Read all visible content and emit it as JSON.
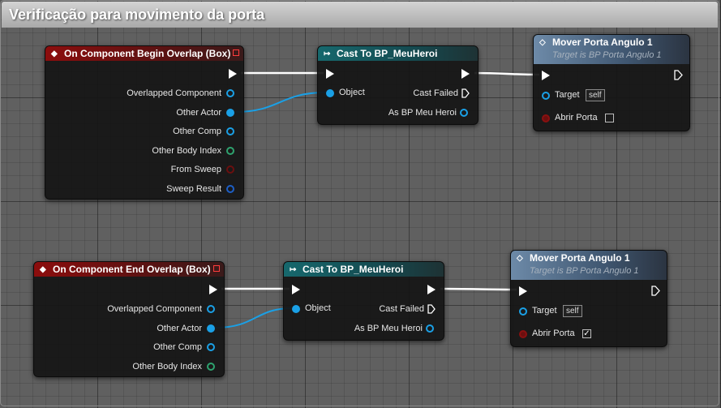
{
  "comment": {
    "title": "Verificação para movimento da porta"
  },
  "colors": {
    "object_pin": "#1aa0e6",
    "struct_pin": "#2ea36f",
    "bool_pin": "#8a1010",
    "wire_exec": "#ffffff",
    "wire_object": "#1aa0e6"
  },
  "event_begin": {
    "title": "On Component Begin Overlap (Box)",
    "pins": [
      "Overlapped Component",
      "Other Actor",
      "Other Comp",
      "Other Body Index",
      "From Sweep",
      "Sweep Result"
    ]
  },
  "cast_begin": {
    "title": "Cast To BP_MeuHeroi",
    "object": "Object",
    "cast_failed": "Cast Failed",
    "as_hero": "As BP Meu Heroi"
  },
  "func_begin": {
    "title": "Mover Porta Angulo 1",
    "subtitle": "Target is BP Porta Angulo 1",
    "target": "Target",
    "self": "self",
    "abrir": "Abrir Porta",
    "abrir_checked": false
  },
  "event_end": {
    "title": "On Component End Overlap (Box)",
    "pins": [
      "Overlapped Component",
      "Other Actor",
      "Other Comp",
      "Other Body Index"
    ]
  },
  "cast_end": {
    "title": "Cast To BP_MeuHeroi",
    "object": "Object",
    "cast_failed": "Cast Failed",
    "as_hero": "As BP Meu Heroi"
  },
  "func_end": {
    "title": "Mover Porta Angulo 1",
    "subtitle": "Target is BP Porta Angulo 1",
    "target": "Target",
    "self": "self",
    "abrir": "Abrir Porta",
    "abrir_checked": true
  },
  "icons": {
    "event": "event-diamond-icon",
    "cast": "cast-arrow-icon",
    "function": "function-diamond-icon"
  }
}
